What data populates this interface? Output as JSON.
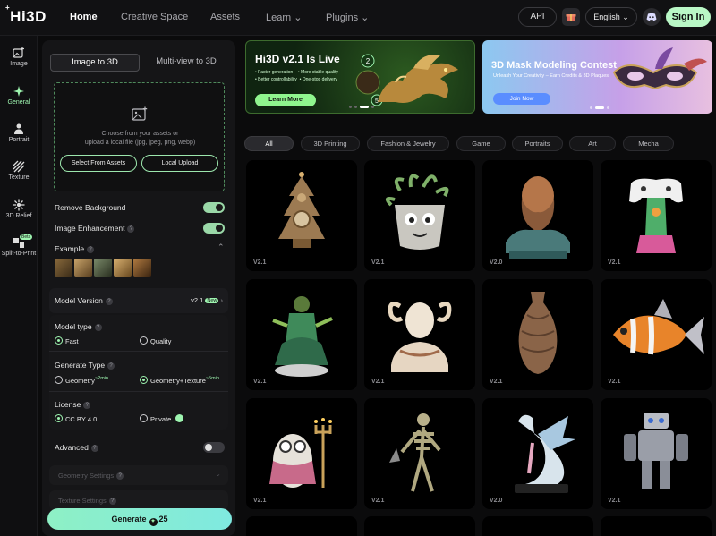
{
  "header": {
    "logo": "Hi3D",
    "logo_mark": "+",
    "nav": [
      "Home",
      "Creative Space",
      "Assets",
      "Learn",
      "Plugins"
    ],
    "api": "API",
    "language": "English",
    "signin": "Sign In"
  },
  "sidebar": {
    "items": [
      {
        "label": "Image",
        "icon": "image-plus-icon"
      },
      {
        "label": "General",
        "icon": "sparkle-icon"
      },
      {
        "label": "Portrait",
        "icon": "portrait-icon"
      },
      {
        "label": "Texture",
        "icon": "texture-icon"
      },
      {
        "label": "3D Relief",
        "icon": "relief-icon"
      },
      {
        "label": "Split-to-Print",
        "icon": "split-icon",
        "badge": "Beta"
      }
    ]
  },
  "panel": {
    "tabs": [
      "Image to 3D",
      "Multi-view to 3D"
    ],
    "upload_text_1": "Choose from your assets or",
    "upload_text_2": "upload a local file (jpg, jpeg, png, webp)",
    "select_assets": "Select From Assets",
    "local_upload": "Local Upload",
    "remove_background": "Remove Background",
    "image_enhancement": "Image Enhancement",
    "example": "Example",
    "model_version_label": "Model Version",
    "model_version_value": "v2.1",
    "model_version_badge": "New",
    "model_type_label": "Model type",
    "model_type_fast": "Fast",
    "model_type_quality": "Quality",
    "generate_type_label": "Generate Type",
    "generate_geometry": "Geometry",
    "generate_geometry_time": "~2min",
    "generate_geotex": "Geometry+Texture",
    "generate_geotex_time": "~5min",
    "license_label": "License",
    "license_cc": "CC BY 4.0",
    "license_private": "Private",
    "advanced": "Advanced",
    "geometry_settings": "Geometry Settings",
    "texture_settings": "Texture Settings",
    "generate": "Generate",
    "generate_cost": "25"
  },
  "banners": {
    "b1_title": "Hi3D v2.1 Is Live",
    "b1_features": [
      "• Faster generation",
      "• More stable quality",
      "• Better controllability",
      "• One-stop delivery"
    ],
    "b1_button": "Learn More",
    "b1_step1": "2",
    "b1_step2": "5",
    "b2_title": "3D Mask Modeling Contest",
    "b2_sub": "Unleash Your Creativity – Earn Credits & 3D Plaques!",
    "b2_button": "Join Now"
  },
  "filters": [
    "All",
    "3D Printing",
    "Fashion & Jewelry",
    "Game",
    "Portraits",
    "Art",
    "Mecha"
  ],
  "gallery": [
    {
      "version": "V2.1",
      "subject": "clock-tree"
    },
    {
      "version": "V2.1",
      "subject": "plant-pot"
    },
    {
      "version": "V2.0",
      "subject": "bearded-bust"
    },
    {
      "version": "V2.1",
      "subject": "controller-figure"
    },
    {
      "version": "V2.1",
      "subject": "green-warrior"
    },
    {
      "version": "V2.1",
      "subject": "horned-bust"
    },
    {
      "version": "V2.1",
      "subject": "vase"
    },
    {
      "version": "V2.1",
      "subject": "mech-fish"
    },
    {
      "version": "V2.1",
      "subject": "owl-candles"
    },
    {
      "version": "V2.1",
      "subject": "skeleton"
    },
    {
      "version": "V2.0",
      "subject": "dragon"
    },
    {
      "version": "V2.1",
      "subject": "robot"
    }
  ],
  "colors": {
    "accent": "#9ef5b0",
    "background": "#0b0b0c"
  }
}
